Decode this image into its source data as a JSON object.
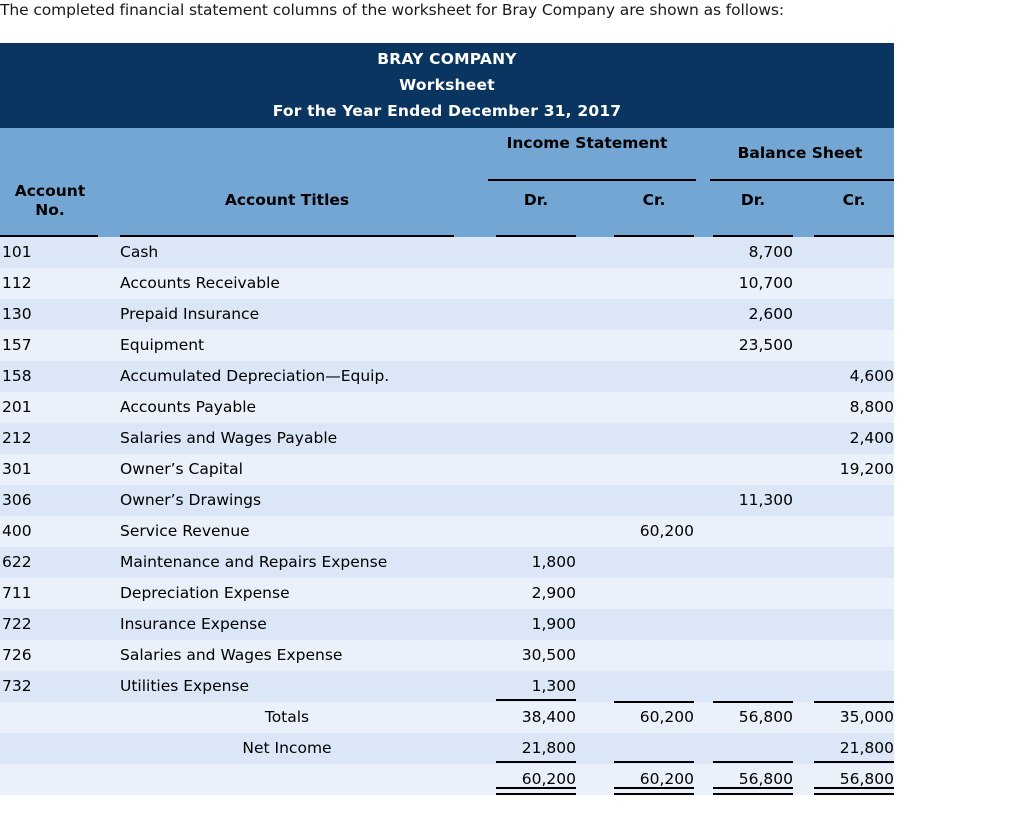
{
  "intro": "The completed financial statement columns of the worksheet for Bray Company are shown as follows:",
  "worksheet": {
    "company": "BRAY COMPANY",
    "document": "Worksheet",
    "period": "For the Year Ended December 31, 2017",
    "colors": {
      "title_bg": "#0b3561",
      "header_bg": "#74a6d4",
      "row_bg": "#eaf1fb",
      "row_alt_bg": "#dbe6f6"
    },
    "group_headers": {
      "income_statement": "Income Statement",
      "balance_sheet": "Balance Sheet"
    },
    "columns": {
      "account_no": "Account No.",
      "account_titles": "Account Titles",
      "is_dr": "Dr.",
      "is_cr": "Cr.",
      "bs_dr": "Dr.",
      "bs_cr": "Cr."
    },
    "rows": [
      {
        "no": "101",
        "title": "Cash",
        "is_dr": "",
        "is_cr": "",
        "bs_dr": "8,700",
        "bs_cr": ""
      },
      {
        "no": "112",
        "title": "Accounts Receivable",
        "is_dr": "",
        "is_cr": "",
        "bs_dr": "10,700",
        "bs_cr": ""
      },
      {
        "no": "130",
        "title": "Prepaid Insurance",
        "is_dr": "",
        "is_cr": "",
        "bs_dr": "2,600",
        "bs_cr": ""
      },
      {
        "no": "157",
        "title": "Equipment",
        "is_dr": "",
        "is_cr": "",
        "bs_dr": "23,500",
        "bs_cr": ""
      },
      {
        "no": "158",
        "title": "Accumulated Depreciation—Equip.",
        "is_dr": "",
        "is_cr": "",
        "bs_dr": "",
        "bs_cr": "4,600"
      },
      {
        "no": "201",
        "title": "Accounts Payable",
        "is_dr": "",
        "is_cr": "",
        "bs_dr": "",
        "bs_cr": "8,800"
      },
      {
        "no": "212",
        "title": "Salaries and Wages Payable",
        "is_dr": "",
        "is_cr": "",
        "bs_dr": "",
        "bs_cr": "2,400"
      },
      {
        "no": "301",
        "title": "Owner’s Capital",
        "is_dr": "",
        "is_cr": "",
        "bs_dr": "",
        "bs_cr": "19,200"
      },
      {
        "no": "306",
        "title": "Owner’s Drawings",
        "is_dr": "",
        "is_cr": "",
        "bs_dr": "11,300",
        "bs_cr": ""
      },
      {
        "no": "400",
        "title": "Service Revenue",
        "is_dr": "",
        "is_cr": "60,200",
        "bs_dr": "",
        "bs_cr": ""
      },
      {
        "no": "622",
        "title": "Maintenance and Repairs Expense",
        "is_dr": "1,800",
        "is_cr": "",
        "bs_dr": "",
        "bs_cr": ""
      },
      {
        "no": "711",
        "title": "Depreciation Expense",
        "is_dr": "2,900",
        "is_cr": "",
        "bs_dr": "",
        "bs_cr": ""
      },
      {
        "no": "722",
        "title": "Insurance Expense",
        "is_dr": "1,900",
        "is_cr": "",
        "bs_dr": "",
        "bs_cr": ""
      },
      {
        "no": "726",
        "title": "Salaries and Wages Expense",
        "is_dr": "30,500",
        "is_cr": "",
        "bs_dr": "",
        "bs_cr": ""
      },
      {
        "no": "732",
        "title": "Utilities Expense",
        "is_dr": "1,300",
        "is_cr": "",
        "bs_dr": "",
        "bs_cr": ""
      }
    ],
    "totals_row": {
      "no": "",
      "title": "Totals",
      "is_dr": "38,400",
      "is_cr": "60,200",
      "bs_dr": "56,800",
      "bs_cr": "35,000"
    },
    "net_income_row": {
      "no": "",
      "title": "Net Income",
      "is_dr": "21,800",
      "is_cr": "",
      "bs_dr": "",
      "bs_cr": "21,800"
    },
    "grand_total_row": {
      "no": "",
      "title": "",
      "is_dr": "60,200",
      "is_cr": "60,200",
      "bs_dr": "56,800",
      "bs_cr": "56,800"
    }
  }
}
